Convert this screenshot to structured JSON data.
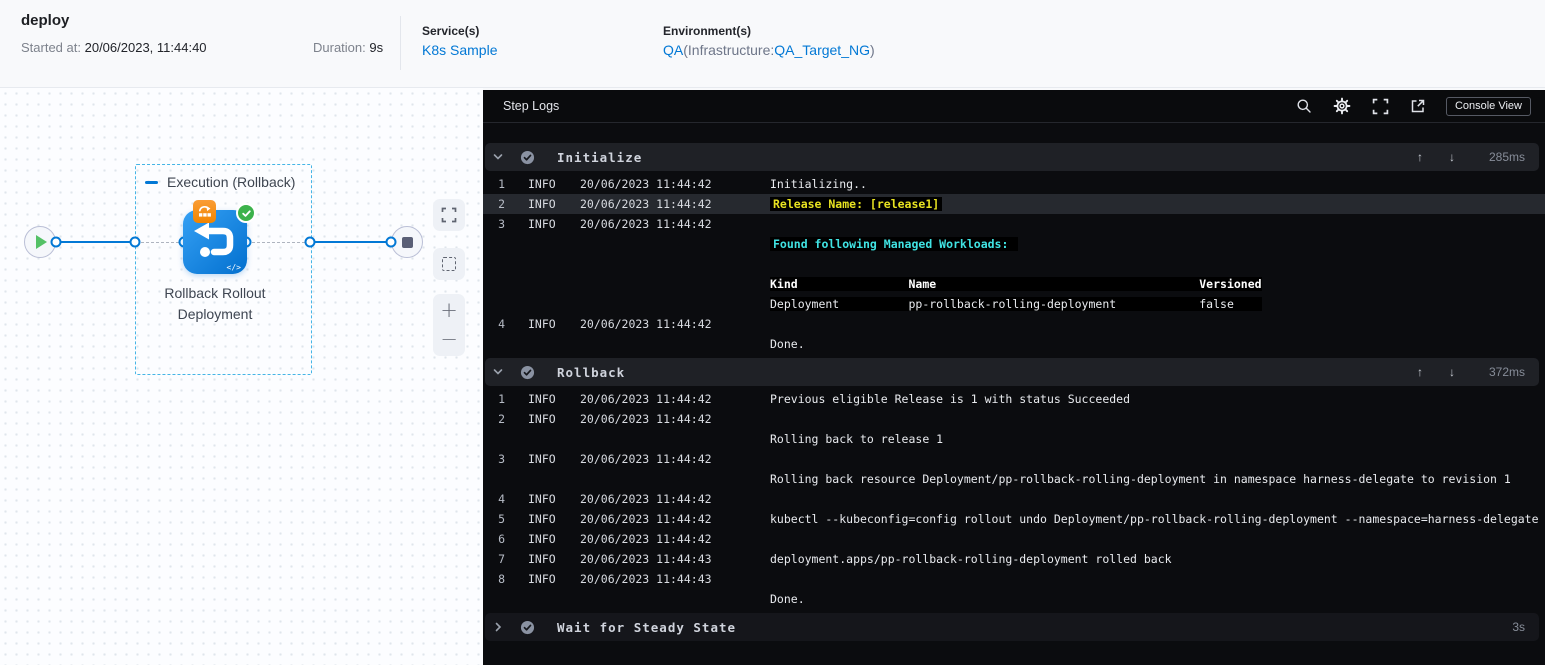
{
  "header": {
    "title": "deploy",
    "started_label": "Started at:",
    "started_value": "20/06/2023, 11:44:40",
    "duration_label": "Duration:",
    "duration_value": "9s",
    "services_label": "Service(s)",
    "services_value": "K8s Sample",
    "environments_label": "Environment(s)",
    "environment_name": "QA",
    "environment_infra_prefix": "(Infrastructure:",
    "environment_infra": "QA_Target_NG",
    "environment_suffix": ")"
  },
  "canvas": {
    "stage_label": "Execution (Rollback)",
    "node_label": "Rollback Rollout Deployment",
    "code_glyph": "</>",
    "zoom_in_glyph": "+",
    "zoom_out_glyph": "−"
  },
  "colors": {
    "accent": "#0278d5",
    "success": "#3cb24b",
    "log_yellow": "#e8e321",
    "log_cyan": "#40e3e3"
  },
  "log_panel": {
    "title": "Step Logs",
    "console_view_label": "Console View",
    "icons": {
      "up": "↑",
      "down": "↓"
    },
    "sections": [
      {
        "name": "Initialize",
        "duration": "285ms",
        "state": "expanded",
        "rows": [
          {
            "n": "1",
            "level": "INFO",
            "time": "20/06/2023 11:44:42",
            "lines": [
              {
                "style": "plain",
                "text": "Initializing.."
              }
            ]
          },
          {
            "n": "2",
            "level": "INFO",
            "time": "20/06/2023 11:44:42",
            "highlight": true,
            "lines": [
              {
                "style": "yellow",
                "text": "Release Name: [release1]"
              }
            ]
          },
          {
            "n": "3",
            "level": "INFO",
            "time": "20/06/2023 11:44:42",
            "lines": [
              {
                "style": "blank",
                "text": ""
              },
              {
                "style": "cyan",
                "text": "Found following Managed Workloads: "
              },
              {
                "style": "blank",
                "text": ""
              },
              {
                "style": "th",
                "text": "Kind                Name                                      Versioned"
              },
              {
                "style": "tr",
                "text": "Deployment          pp-rollback-rolling-deployment            false    "
              }
            ]
          },
          {
            "n": "4",
            "level": "INFO",
            "time": "20/06/2023 11:44:42",
            "lines": [
              {
                "style": "blank",
                "text": ""
              },
              {
                "style": "plain",
                "text": "Done."
              }
            ]
          }
        ]
      },
      {
        "name": "Rollback",
        "duration": "372ms",
        "state": "expanded",
        "rows": [
          {
            "n": "1",
            "level": "INFO",
            "time": "20/06/2023 11:44:42",
            "lines": [
              {
                "style": "plain",
                "text": "Previous eligible Release is 1 with status Succeeded"
              }
            ]
          },
          {
            "n": "2",
            "level": "INFO",
            "time": "20/06/2023 11:44:42",
            "lines": [
              {
                "style": "blank",
                "text": ""
              },
              {
                "style": "plain",
                "text": "Rolling back to release 1"
              }
            ]
          },
          {
            "n": "3",
            "level": "INFO",
            "time": "20/06/2023 11:44:42",
            "lines": [
              {
                "style": "blank",
                "text": ""
              },
              {
                "style": "plain",
                "text": "Rolling back resource Deployment/pp-rollback-rolling-deployment in namespace harness-delegate to revision 1"
              }
            ]
          },
          {
            "n": "4",
            "level": "INFO",
            "time": "20/06/2023 11:44:42",
            "lines": [
              {
                "style": "blank",
                "text": ""
              }
            ]
          },
          {
            "n": "5",
            "level": "INFO",
            "time": "20/06/2023 11:44:42",
            "lines": [
              {
                "style": "plain",
                "text": "kubectl --kubeconfig=config rollout undo Deployment/pp-rollback-rolling-deployment --namespace=harness-delegate"
              }
            ]
          },
          {
            "n": "6",
            "level": "INFO",
            "time": "20/06/2023 11:44:42",
            "lines": [
              {
                "style": "blank",
                "text": ""
              }
            ]
          },
          {
            "n": "7",
            "level": "INFO",
            "time": "20/06/2023 11:44:43",
            "lines": [
              {
                "style": "plain",
                "text": "deployment.apps/pp-rollback-rolling-deployment rolled back"
              }
            ]
          },
          {
            "n": "8",
            "level": "INFO",
            "time": "20/06/2023 11:44:43",
            "lines": [
              {
                "style": "blank",
                "text": ""
              },
              {
                "style": "plain",
                "text": "Done."
              }
            ]
          }
        ]
      },
      {
        "name": "Wait for Steady State",
        "duration": "3s",
        "state": "collapsed",
        "rows": []
      }
    ]
  }
}
